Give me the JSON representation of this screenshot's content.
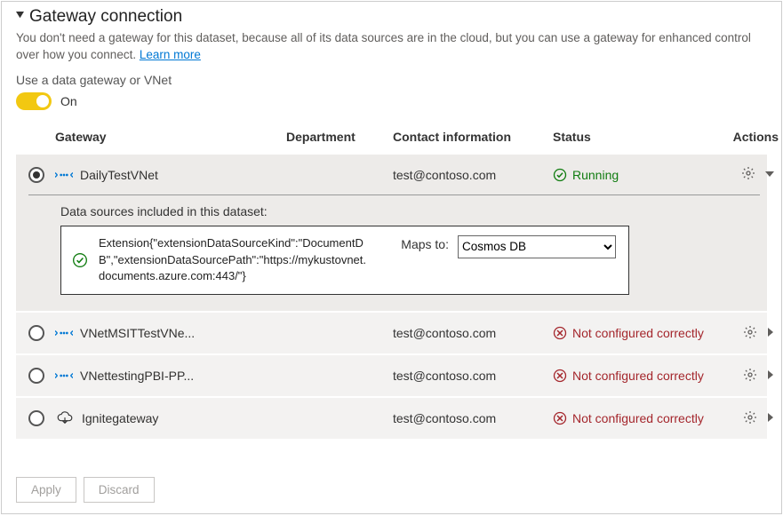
{
  "header": {
    "title": "Gateway connection",
    "description_prefix": "You don't need a gateway for this dataset, because all of its data sources are in the cloud, but you can use a gateway for enhanced control over how you connect. ",
    "learn_more": "Learn more",
    "use_label": "Use a data gateway or VNet",
    "toggle_state": "On"
  },
  "columns": {
    "gateway": "Gateway",
    "department": "Department",
    "contact": "Contact information",
    "status": "Status",
    "actions": "Actions"
  },
  "status_text": {
    "running": "Running",
    "not_configured": "Not configured correctly"
  },
  "gateways": [
    {
      "name": "DailyTestVNet",
      "type": "vnet",
      "department": "",
      "contact": "test@contoso.com",
      "status": "running",
      "selected": true,
      "expanded": true
    },
    {
      "name": "VNetMSITTestVNe...",
      "type": "vnet",
      "department": "",
      "contact": "test@contoso.com",
      "status": "not_configured",
      "selected": false,
      "expanded": false
    },
    {
      "name": "VNettestingPBI-PP...",
      "type": "vnet",
      "department": "",
      "contact": "test@contoso.com",
      "status": "not_configured",
      "selected": false,
      "expanded": false
    },
    {
      "name": "Ignitegateway",
      "type": "cloud",
      "department": "",
      "contact": "test@contoso.com",
      "status": "not_configured",
      "selected": false,
      "expanded": false
    }
  ],
  "expanded": {
    "title": "Data sources included in this dataset:",
    "source_text": "Extension{\"extensionDataSourceKind\":\"DocumentDB\",\"extensionDataSourcePath\":\"https://mykustovnet.documents.azure.com:443/\"}",
    "maps_to_label": "Maps to:",
    "maps_to_value": "Cosmos DB"
  },
  "footer": {
    "apply": "Apply",
    "discard": "Discard"
  }
}
